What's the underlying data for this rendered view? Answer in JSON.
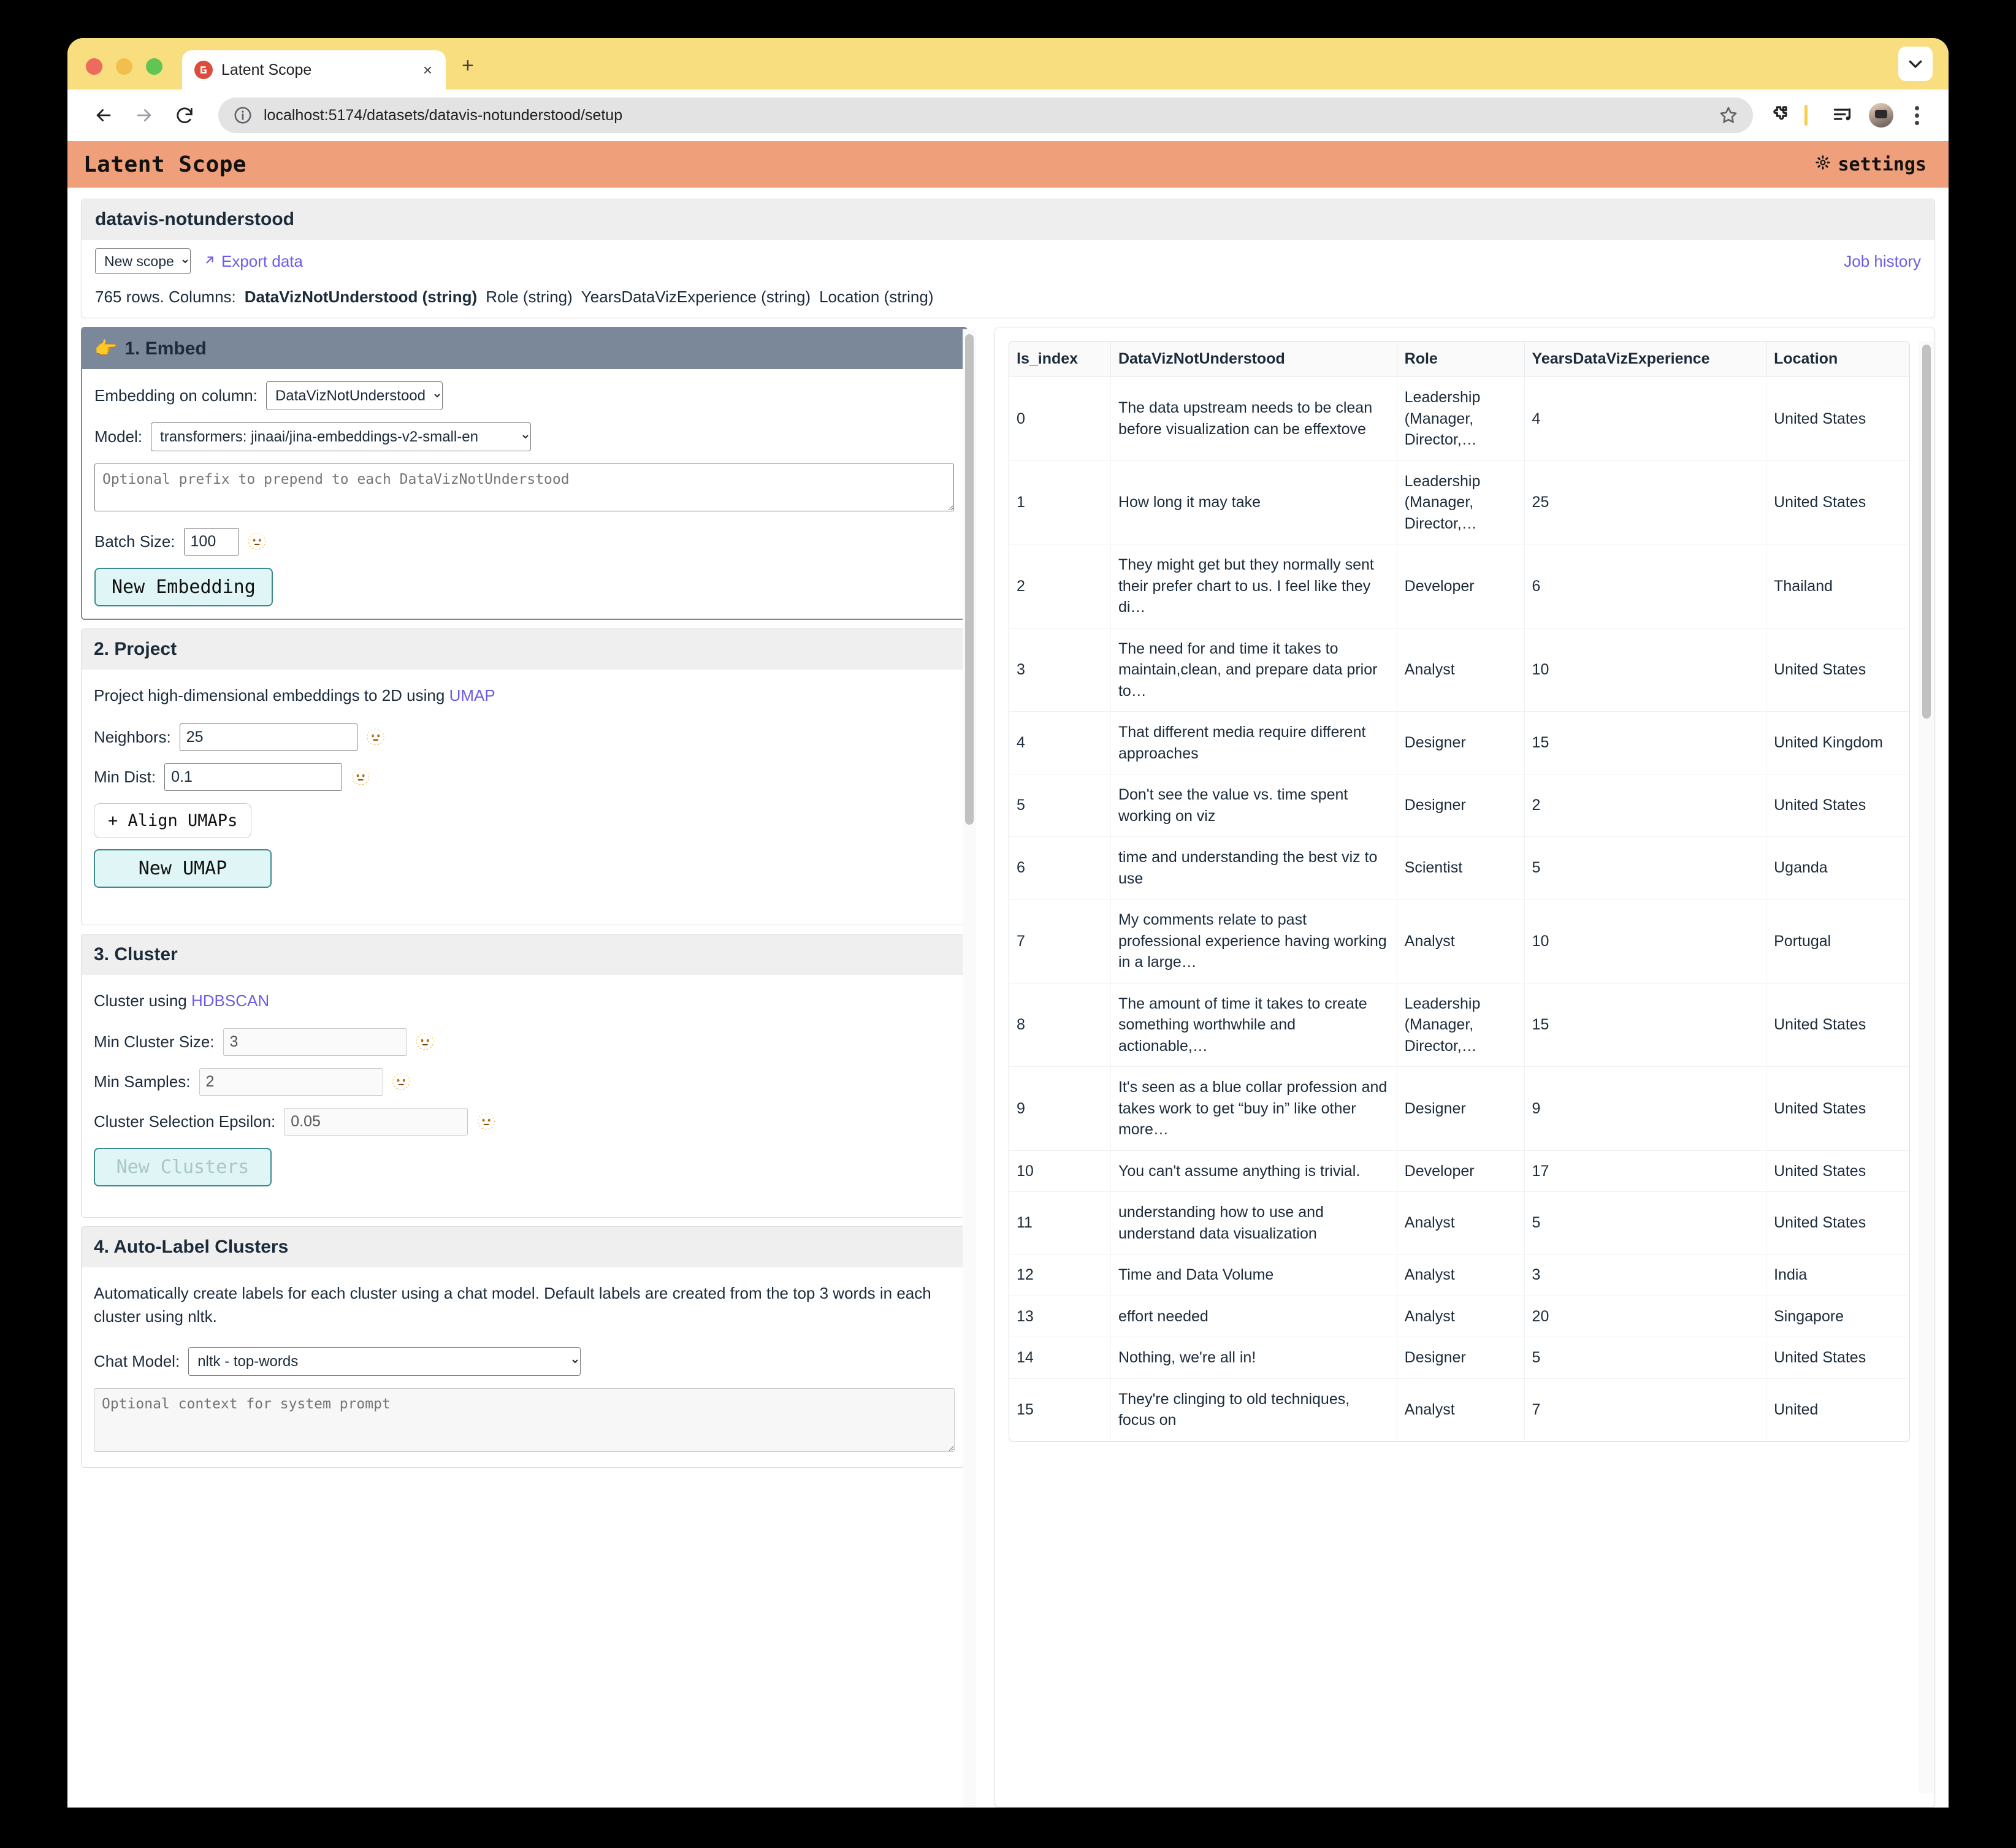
{
  "browser": {
    "tab": {
      "title": "Latent Scope",
      "favicon": "latent-scope-logo",
      "close_label": "×"
    },
    "new_tab_label": "+",
    "url": "localhost:5174/datasets/datavis-notunderstood/setup",
    "nav": {
      "back": "←",
      "forward": "→",
      "reload": "↻"
    },
    "toolbar_icons": [
      "bookmark-star-icon",
      "extensions-icon",
      "reading-list-icon",
      "profile-avatar",
      "kebab-menu-icon"
    ]
  },
  "app": {
    "title": "Latent Scope",
    "settings_label": "settings",
    "settings_icon": "gear-icon"
  },
  "dataset": {
    "name": "datavis-notunderstood",
    "scope_select_value": "New scope",
    "scope_options": [
      "New scope"
    ],
    "export_label": "Export data",
    "export_icon": "arrow-up-right-icon",
    "job_history_label": "Job history",
    "rows_prefix": "765 rows. Columns:",
    "columns": [
      {
        "label": "DataVizNotUnderstood (string)",
        "primary": true
      },
      {
        "label": "Role (string)",
        "primary": false
      },
      {
        "label": "YearsDataVizExperience (string)",
        "primary": false
      },
      {
        "label": "Location (string)",
        "primary": false
      }
    ]
  },
  "stages": {
    "embed": {
      "heading": "1. Embed",
      "pointer_icon": "pointing-right-hand",
      "column_label": "Embedding on column:",
      "column_value": "DataVizNotUnderstood",
      "model_label": "Model:",
      "model_value": "transformers: jinaai/jina-embeddings-v2-small-en",
      "prefix_placeholder": "Optional prefix to prepend to each DataVizNotUnderstood",
      "batch_label": "Batch Size:",
      "batch_value": "100",
      "tooltip_icon": "help-face-icon",
      "button": "New Embedding"
    },
    "project": {
      "heading": "2. Project",
      "description_pre": "Project high-dimensional embeddings to 2D using ",
      "description_link": "UMAP",
      "neighbors_label": "Neighbors:",
      "neighbors_value": "25",
      "mindist_label": "Min Dist:",
      "mindist_value": "0.1",
      "align_button": "+ Align UMAPs",
      "button": "New UMAP"
    },
    "cluster": {
      "heading": "3. Cluster",
      "description_pre": "Cluster using ",
      "description_link": "HDBSCAN",
      "min_cluster_label": "Min Cluster Size:",
      "min_cluster_value": "3",
      "min_samples_label": "Min Samples:",
      "min_samples_value": "2",
      "epsilon_label": "Cluster Selection Epsilon:",
      "epsilon_value": "0.05",
      "button": "New Clusters"
    },
    "autolabel": {
      "heading": "4. Auto-Label Clusters",
      "description": "Automatically create labels for each cluster using a chat model. Default labels are created from the top 3 words in each cluster using nltk.",
      "chat_model_label": "Chat Model:",
      "chat_model_value": "nltk - top-words",
      "prompt_placeholder": "Optional context for system prompt"
    }
  },
  "table": {
    "headers": [
      "ls_index",
      "DataVizNotUnderstood",
      "Role",
      "YearsDataVizExperience",
      "Location"
    ],
    "rows": [
      [
        "0",
        "The data upstream needs to be clean before visualization can be effextove",
        "Leadership (Manager, Director,…",
        "4",
        "United States"
      ],
      [
        "1",
        "How long it may take",
        "Leadership (Manager, Director,…",
        "25",
        "United States"
      ],
      [
        "2",
        "They might get but they normally sent their prefer chart to us. I feel like they di…",
        "Developer",
        "6",
        "Thailand"
      ],
      [
        "3",
        "The need for and time it takes to maintain,clean, and prepare data prior to…",
        "Analyst",
        "10",
        "United States"
      ],
      [
        "4",
        "That different media require different approaches",
        "Designer",
        "15",
        "United Kingdom"
      ],
      [
        "5",
        "Don't see the value vs. time spent working on viz",
        "Designer",
        "2",
        "United States"
      ],
      [
        "6",
        "time and understanding the best viz to use",
        "Scientist",
        "5",
        "Uganda"
      ],
      [
        "7",
        "My comments relate to past professional experience having working in a large…",
        "Analyst",
        "10",
        "Portugal"
      ],
      [
        "8",
        "The amount of time it takes to create something worthwhile and actionable,…",
        "Leadership (Manager, Director,…",
        "15",
        "United States"
      ],
      [
        "9",
        "It's seen as a blue collar profession and takes work to get “buy in” like other more…",
        "Designer",
        "9",
        "United States"
      ],
      [
        "10",
        "You can't assume anything is trivial.",
        "Developer",
        "17",
        "United States"
      ],
      [
        "11",
        "understanding how to use and understand data visualization",
        "Analyst",
        "5",
        "United States"
      ],
      [
        "12",
        "Time and Data Volume",
        "Analyst",
        "3",
        "India"
      ],
      [
        "13",
        "effort needed",
        "Analyst",
        "20",
        "Singapore"
      ],
      [
        "14",
        "Nothing, we're all in!",
        "Designer",
        "5",
        "United States"
      ],
      [
        "15",
        "They're clinging to old techniques, focus on",
        "Analyst",
        "7",
        "United"
      ]
    ]
  },
  "colors": {
    "app_header": "#efa07a",
    "tab_strip": "#f8de7e",
    "accent_link": "#6b5ce7",
    "active_stage": "#7a8899",
    "button_fill": "#dff5f6",
    "button_border": "#3b8a8f"
  }
}
